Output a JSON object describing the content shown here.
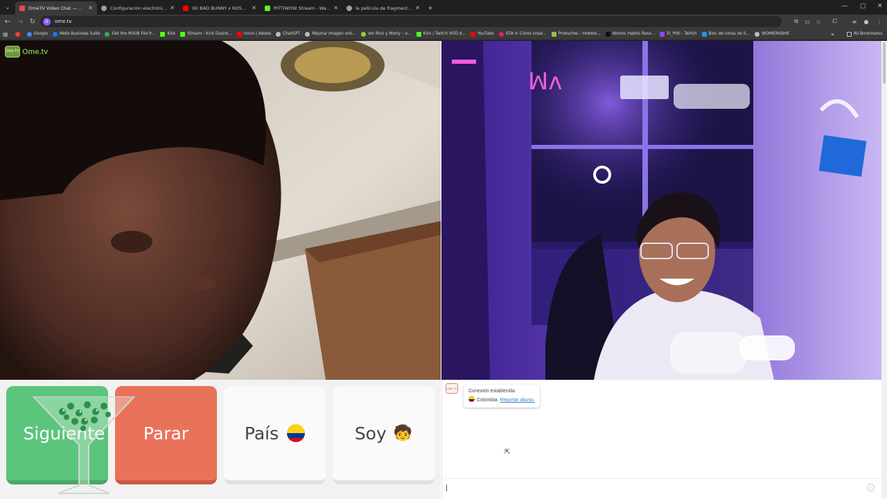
{
  "browser": {
    "tabs": [
      {
        "title": "OmeTV Video Chat — Ome",
        "active": true,
        "color": "#e5484d"
      },
      {
        "title": "Configuración electrónica cero",
        "active": false,
        "color": "#9aa0a6"
      },
      {
        "title": "(6) BAD BUNNY x ROSALÍA - La",
        "active": false,
        "color": "#ff0000"
      },
      {
        "title": "PITTIWOW Stream - Watch Live",
        "active": false,
        "color": "#53fc18"
      },
      {
        "title": "la película de fragmentado - Bi",
        "active": false,
        "color": "#9aa0a6"
      }
    ],
    "url": "ome.tv",
    "bookmarks": [
      {
        "label": "",
        "color": "#ff3b3b"
      },
      {
        "label": "Google",
        "color": "#4285f4"
      },
      {
        "label": "Meta Business Suite",
        "color": "#1877f2"
      },
      {
        "label": "Get the M3U8 File fr...",
        "color": "#34a853"
      },
      {
        "label": "Kick",
        "color": "#53fc18"
      },
      {
        "label": "Stream - Kick Dashb...",
        "color": "#53fc18"
      },
      {
        "label": "Inicio | Adobe",
        "color": "#ff0000"
      },
      {
        "label": "ChatGPT",
        "color": "#bbbbbb"
      },
      {
        "label": "Mejorar imagen onli...",
        "color": "#bbbbbb"
      },
      {
        "label": "Ver Rick y Morty – o...",
        "color": "#9acd32"
      },
      {
        "label": "Kick / Twitch VOD d...",
        "color": "#53fc18"
      },
      {
        "label": "YouTube",
        "color": "#ff0000"
      },
      {
        "label": "GTA V: Cómo crear...",
        "color": "#e91e63"
      },
      {
        "label": "Productos – Hobbie...",
        "color": "#8bc34a"
      },
      {
        "label": "Atomic Habits Reso...",
        "color": "#222222"
      },
      {
        "label": "El_Pitti - Twitch",
        "color": "#9146ff"
      },
      {
        "label": "Bloc de notas de S...",
        "color": "#2196f3"
      },
      {
        "label": "WOMIER68HE",
        "color": "#bbbbbb"
      }
    ],
    "all_bookmarks": "All Bookmarks"
  },
  "app": {
    "logo_text": "Ome.tv",
    "logo_badge": "Ome TV",
    "buttons": {
      "next": "Siguiente",
      "stop": "Parar",
      "country": "País",
      "gender": "Soy",
      "gender_emoji": "🧒"
    },
    "chat": {
      "avatar": "Ome TV",
      "line1": "Conexión establecida.",
      "country": "Colombia.",
      "report": "Reportar abuso."
    }
  }
}
